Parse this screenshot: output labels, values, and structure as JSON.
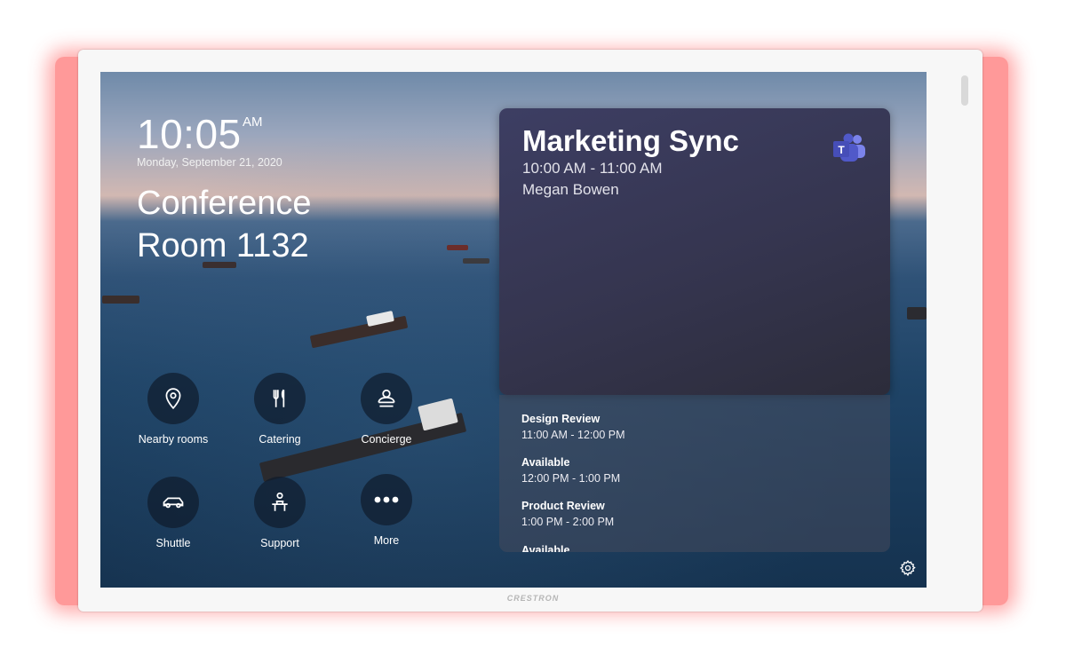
{
  "clock": {
    "time": "10:05",
    "ampm": "AM",
    "date": "Monday, September 21, 2020"
  },
  "room": {
    "name": "Conference Room 1132"
  },
  "actions": [
    {
      "label": "Nearby rooms",
      "icon": "map-pin-icon"
    },
    {
      "label": "Catering",
      "icon": "fork-knife-icon"
    },
    {
      "label": "Concierge",
      "icon": "concierge-bell-icon"
    },
    {
      "label": "Shuttle",
      "icon": "car-icon"
    },
    {
      "label": "Support",
      "icon": "support-person-icon"
    },
    {
      "label": "More",
      "icon": "more-dots-icon"
    }
  ],
  "current_meeting": {
    "title": "Marketing Sync",
    "time": "10:00 AM - 11:00 AM",
    "organizer": "Megan Bowen",
    "app_icon": "microsoft-teams-icon"
  },
  "schedule": [
    {
      "title": "Design Review",
      "time": "11:00 AM - 12:00 PM"
    },
    {
      "title": "Available",
      "time": "12:00 PM - 1:00 PM"
    },
    {
      "title": "Product Review",
      "time": "1:00 PM - 2:00 PM"
    },
    {
      "title": "Available",
      "time": ""
    }
  ],
  "device": {
    "brand": "CRESTRON",
    "status_light_color": "#ff4d4d"
  },
  "settings": {
    "icon": "gear-icon"
  }
}
